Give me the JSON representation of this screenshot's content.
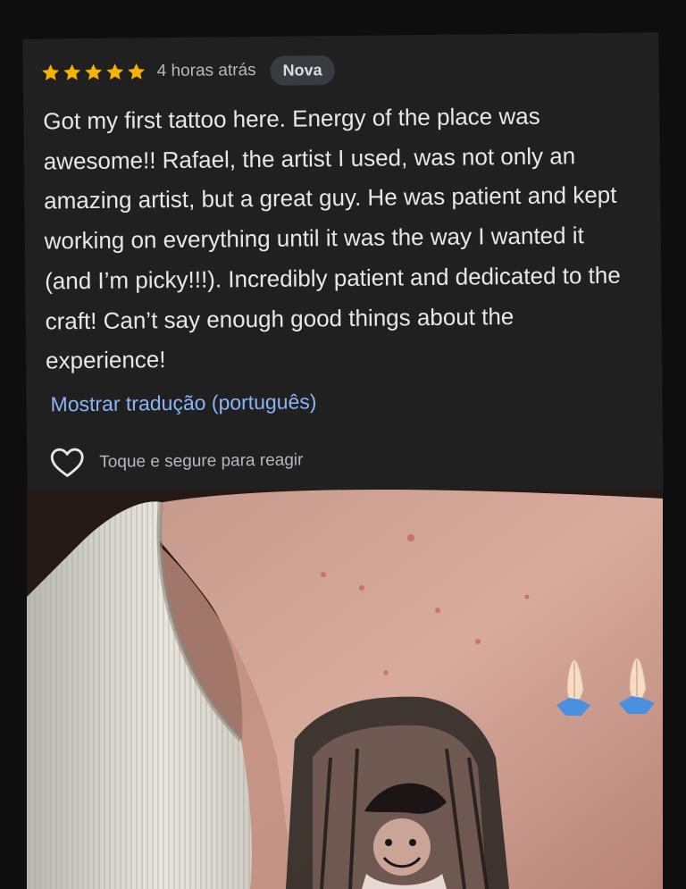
{
  "review": {
    "rating": 5,
    "max_rating": 5,
    "star_color": "#f4b400",
    "time_ago": "4 horas atrás",
    "badge": "Nova",
    "text": "Got my first tattoo here. Energy of the place was awesome!! Rafael, the artist I used, was not only an amazing artist, but a great guy. He was patient and kept working on everything until it was the way I wanted it (and I’m picky!!!). Incredibly patient and dedicated to the craft! Can’t say enough good things about the experience!",
    "translate_link": "Mostrar tradução (português)",
    "react_hint": "Toque e segure para reagir"
  },
  "photo": {
    "overlay_emoji": "praying-hands-emoji",
    "subject": "tattoo-photo"
  },
  "colors": {
    "background": "#0e0e0f",
    "card": "#202021",
    "link": "#8ab4f8",
    "badge_bg": "#3a3b42"
  }
}
